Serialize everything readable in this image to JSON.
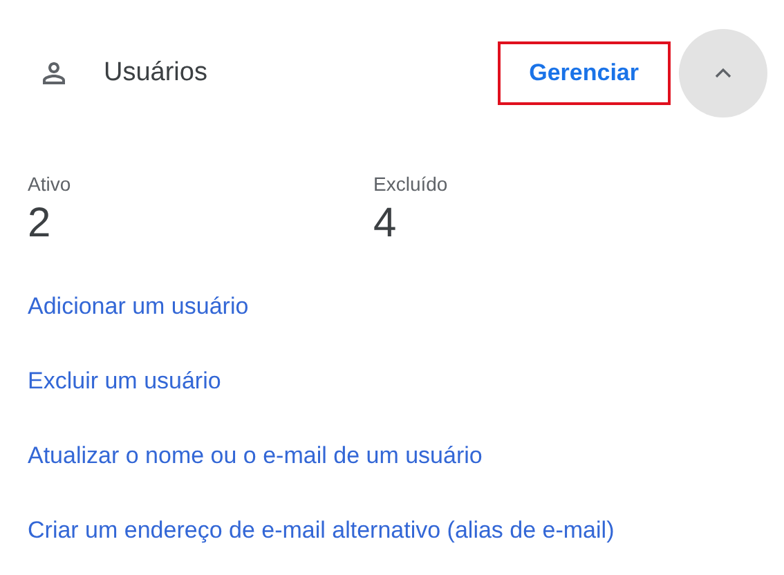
{
  "header": {
    "title": "Usuários",
    "manage_link": {
      "label": "Gerenciar",
      "highlighted": true
    },
    "expanded": true
  },
  "stats": [
    {
      "label": "Ativo",
      "value": "2"
    },
    {
      "label": "Excluído",
      "value": "4"
    }
  ],
  "links": [
    "Adicionar um usuário",
    "Excluir um usuário",
    "Atualizar o nome ou o e-mail de um usuário",
    "Criar um endereço de e-mail alternativo (alias de e-mail)"
  ]
}
